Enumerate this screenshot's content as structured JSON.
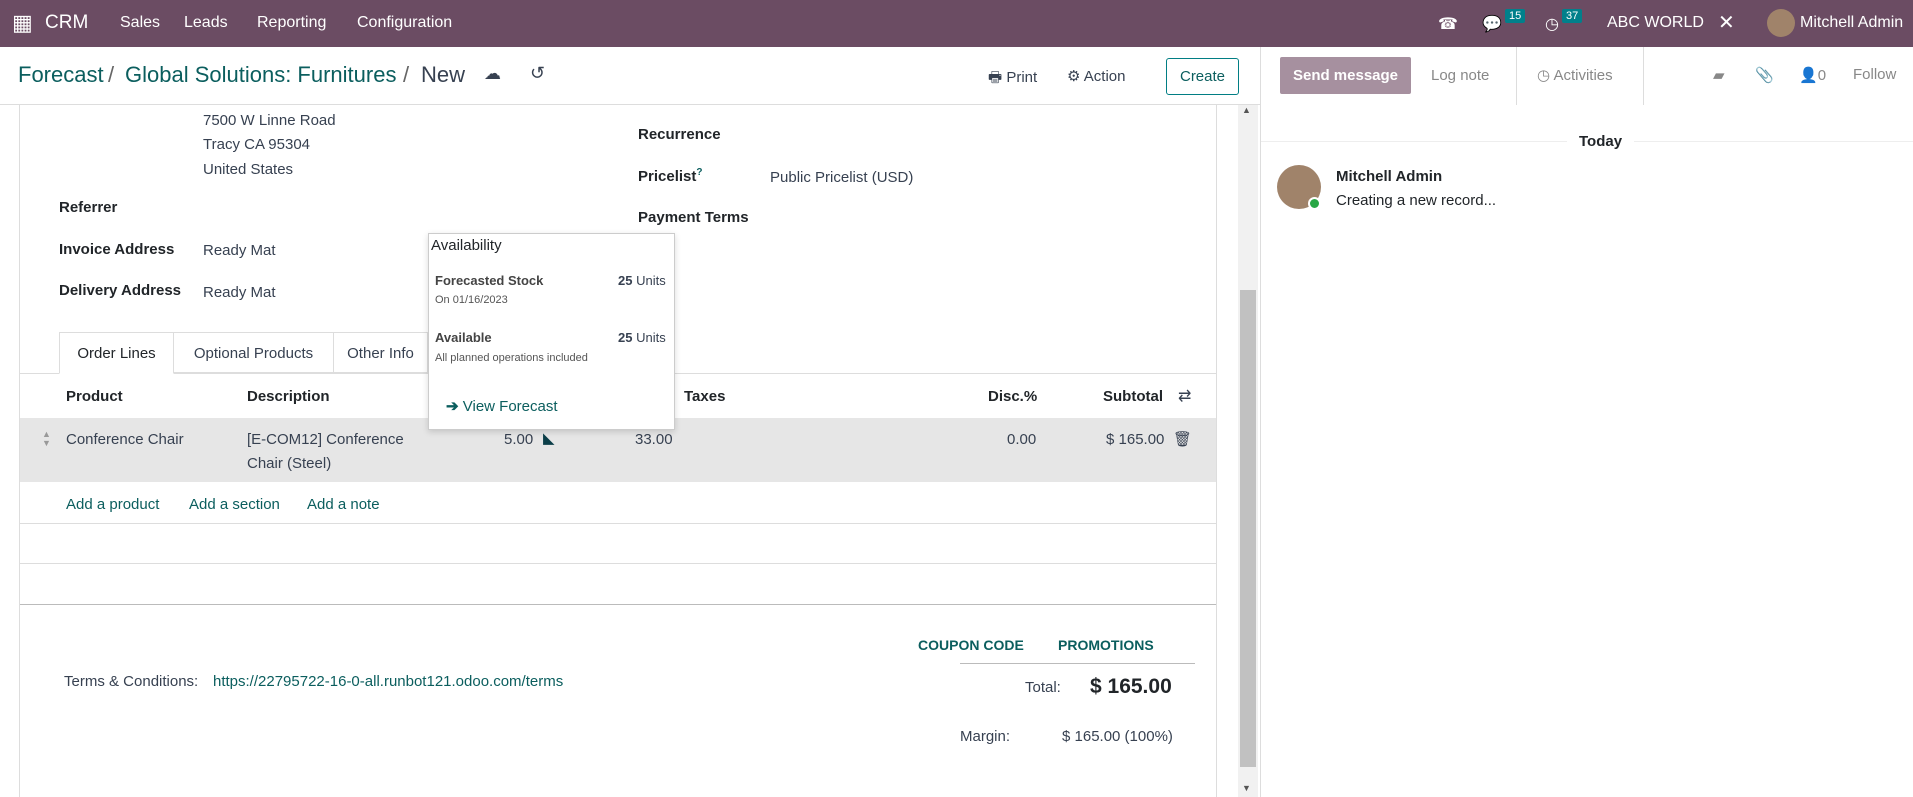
{
  "nav": {
    "app": "CRM",
    "menu": [
      "Sales",
      "Leads",
      "Reporting",
      "Configuration"
    ],
    "messages_count": "15",
    "activities_count": "37",
    "company": "ABC WORLD",
    "user": "Mitchell Admin",
    "color": "#6b4c63"
  },
  "breadcrumb": [
    "Forecast",
    "Global Solutions: Furnitures",
    "New"
  ],
  "toolbar": {
    "print": "Print",
    "action": "Action",
    "create": "Create"
  },
  "chatter": {
    "send_message": "Send message",
    "log_note": "Log note",
    "activities": "Activities",
    "followers": "0",
    "follow": "Follow",
    "today": "Today",
    "author": "Mitchell Admin",
    "message": "Creating a new record..."
  },
  "form": {
    "address": [
      "7500 W Linne Road",
      "Tracy CA 95304",
      "United States"
    ],
    "referrer": "Referrer",
    "invoice_label": "Invoice Address",
    "invoice_value": "Ready Mat",
    "delivery_label": "Delivery Address",
    "delivery_value": "Ready Mat",
    "recurrence": "Recurrence",
    "pricelist_label": "Pricelist",
    "pricelist_help": "?",
    "pricelist_value": "Public Pricelist (USD)",
    "payment_terms": "Payment Terms"
  },
  "tabs": [
    "Order Lines",
    "Optional Products",
    "Other Info"
  ],
  "table": {
    "headers": {
      "product": "Product",
      "description": "Description",
      "taxes": "Taxes",
      "disc": "Disc.%",
      "subtotal": "Subtotal"
    },
    "row": {
      "product": "Conference Chair",
      "description1": "[E-COM12] Conference",
      "description2": "Chair (Steel)",
      "qty": "5.00",
      "price": "33.00",
      "disc": "0.00",
      "subtotal": "$ 165.00"
    },
    "add_product": "Add a product",
    "add_section": "Add a section",
    "add_note": "Add a note"
  },
  "popover": {
    "title": "Availability",
    "forecast_label": "Forecasted Stock",
    "forecast_qty": "25",
    "unit": "Units",
    "forecast_date": "On 01/16/2023",
    "available_label": "Available",
    "available_qty": "25",
    "available_note": "All planned operations included",
    "view": "View Forecast"
  },
  "footer": {
    "coupon": "COUPON CODE",
    "promotions": "PROMOTIONS",
    "terms_label": "Terms & Conditions:",
    "terms_link": "https://22795722-16-0-all.runbot121.odoo.com/terms",
    "total_label": "Total:",
    "total": "$ 165.00",
    "margin_label": "Margin:",
    "margin": "$ 165.00 (100%)"
  }
}
